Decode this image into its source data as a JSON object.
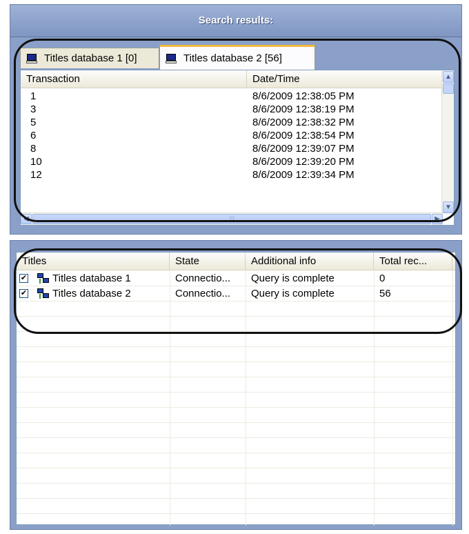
{
  "search_panel": {
    "title": "Search results:",
    "tabs": [
      {
        "label": "Titles database 1 [0]",
        "active": false,
        "icon": "computer-icon"
      },
      {
        "label": "Titles database 2 [56]",
        "active": true,
        "icon": "computer-icon"
      }
    ],
    "columns": [
      "Transaction",
      "Date/Time"
    ],
    "rows": [
      {
        "transaction": "1",
        "datetime": "8/6/2009 12:38:05 PM"
      },
      {
        "transaction": "3",
        "datetime": "8/6/2009 12:38:19 PM"
      },
      {
        "transaction": "5",
        "datetime": "8/6/2009 12:38:32 PM"
      },
      {
        "transaction": "6",
        "datetime": "8/6/2009 12:38:54 PM"
      },
      {
        "transaction": "8",
        "datetime": "8/6/2009 12:39:07 PM"
      },
      {
        "transaction": "10",
        "datetime": "8/6/2009 12:39:20 PM"
      },
      {
        "transaction": "12",
        "datetime": "8/6/2009 12:39:34 PM"
      }
    ]
  },
  "sources_panel": {
    "columns": [
      "Titles",
      "State",
      "Additional info",
      "Total rec..."
    ],
    "rows": [
      {
        "checked": true,
        "icon": "network-icon",
        "title": "Titles database 1",
        "state": "Connectio...",
        "info": "Query is complete",
        "total": "0"
      },
      {
        "checked": true,
        "icon": "network-icon",
        "title": "Titles database 2",
        "state": "Connectio...",
        "info": "Query is complete",
        "total": "56"
      }
    ]
  },
  "colors": {
    "panel_background": "#8aa0c9",
    "active_tab_accent": "#f3b93b",
    "annotation_outline": "#111111"
  }
}
